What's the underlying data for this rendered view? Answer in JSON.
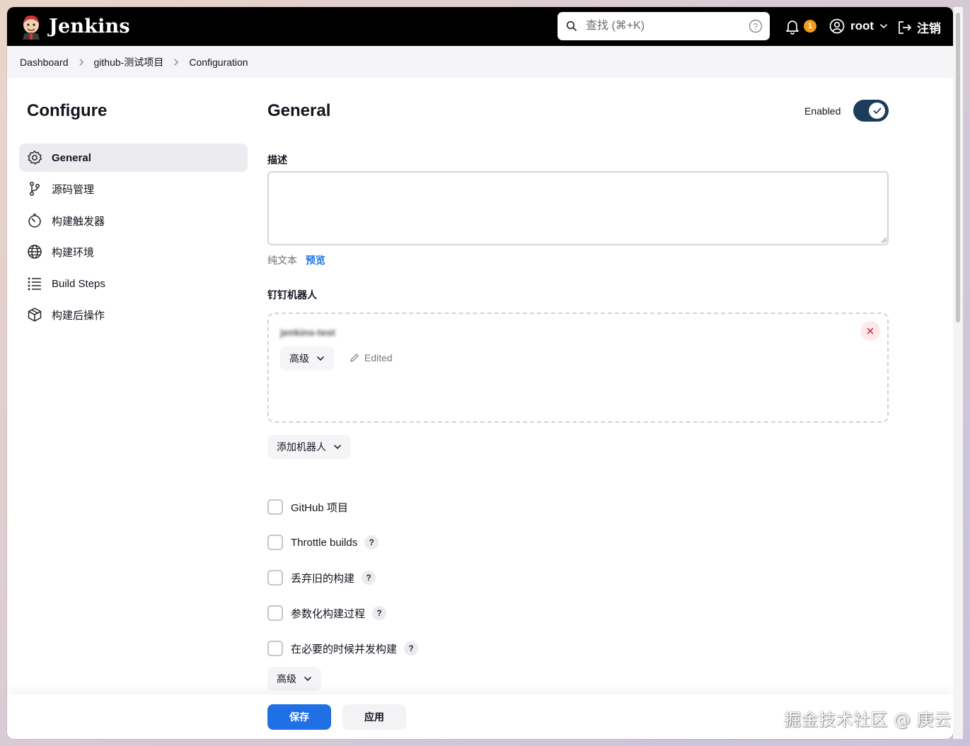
{
  "header": {
    "brand": "Jenkins",
    "search_placeholder": "查找 (⌘+K)",
    "notification_count": "1",
    "user": "root",
    "logout_label": "注销"
  },
  "breadcrumb": [
    "Dashboard",
    "github-测试项目",
    "Configuration"
  ],
  "sidebar": {
    "title": "Configure",
    "items": [
      {
        "label": "General",
        "icon": "gear-icon",
        "active": true
      },
      {
        "label": "源码管理",
        "icon": "source-branch-icon"
      },
      {
        "label": "构建触发器",
        "icon": "timer-icon"
      },
      {
        "label": "构建环境",
        "icon": "globe-icon"
      },
      {
        "label": "Build Steps",
        "icon": "list-steps-icon"
      },
      {
        "label": "构建后操作",
        "icon": "package-icon"
      }
    ]
  },
  "main": {
    "title": "General",
    "enabled_label": "Enabled",
    "enabled": true,
    "description_label": "描述",
    "description_value": "",
    "format_plain": "纯文本",
    "format_preview": "预览",
    "dingtalk_label": "钉钉机器人",
    "robot": {
      "name": "jenkins-test",
      "advanced_label": "高级",
      "edited_label": "Edited"
    },
    "add_robot_label": "添加机器人",
    "checkboxes": [
      {
        "label": "GitHub 项目",
        "help": false,
        "checked": false
      },
      {
        "label": "Throttle builds",
        "help": true,
        "checked": false
      },
      {
        "label": "丢弃旧的构建",
        "help": true,
        "checked": false
      },
      {
        "label": "参数化构建过程",
        "help": true,
        "checked": false
      },
      {
        "label": "在必要的时候并发构建",
        "help": true,
        "checked": false
      }
    ],
    "help_glyph": "?",
    "advanced_label": "高级"
  },
  "footer": {
    "save_label": "保存",
    "apply_label": "应用"
  },
  "watermark": "掘金技术社区 @ 庚云",
  "colors": {
    "header_bg": "#000000",
    "primary_blue": "#1f6fe5",
    "toggle_on": "#1c3d5a",
    "badge_orange": "#f59b17",
    "link_blue": "#1a74e8"
  }
}
